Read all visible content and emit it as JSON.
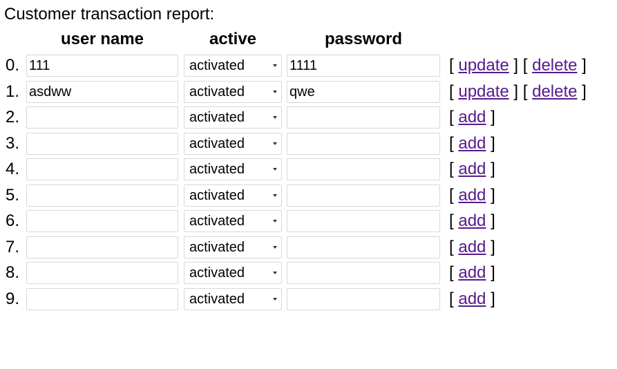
{
  "page": {
    "title": "Customer transaction report:"
  },
  "headers": {
    "user_name": "user name",
    "active": "active",
    "password": "password"
  },
  "bracket_open": "[",
  "bracket_close": "]",
  "rows": [
    {
      "index": "0.",
      "username": "111",
      "active": "activated",
      "password": "1111",
      "actions": [
        "update",
        "delete"
      ]
    },
    {
      "index": "1.",
      "username": "asdww",
      "active": "activated",
      "password": "qwe",
      "actions": [
        "update",
        "delete"
      ]
    },
    {
      "index": "2.",
      "username": "",
      "active": "activated",
      "password": "",
      "actions": [
        "add"
      ]
    },
    {
      "index": "3.",
      "username": "",
      "active": "activated",
      "password": "",
      "actions": [
        "add"
      ]
    },
    {
      "index": "4.",
      "username": "",
      "active": "activated",
      "password": "",
      "actions": [
        "add"
      ]
    },
    {
      "index": "5.",
      "username": "",
      "active": "activated",
      "password": "",
      "actions": [
        "add"
      ]
    },
    {
      "index": "6.",
      "username": "",
      "active": "activated",
      "password": "",
      "actions": [
        "add"
      ]
    },
    {
      "index": "7.",
      "username": "",
      "active": "activated",
      "password": "",
      "actions": [
        "add"
      ]
    },
    {
      "index": "8.",
      "username": "",
      "active": "activated",
      "password": "",
      "actions": [
        "add"
      ]
    },
    {
      "index": "9.",
      "username": "",
      "active": "activated",
      "password": "",
      "actions": [
        "add"
      ]
    }
  ],
  "colors": {
    "link": "#551a8b",
    "field_border": "#d8d8d8"
  }
}
